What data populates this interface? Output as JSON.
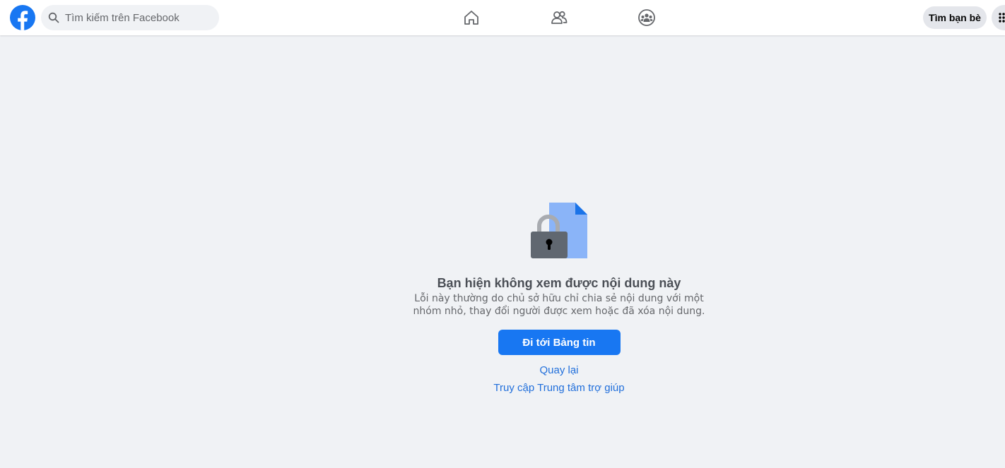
{
  "header": {
    "logo_icon": "facebook-logo-icon",
    "search": {
      "placeholder": "Tìm kiếm trên Facebook",
      "icon": "search-icon"
    },
    "nav": [
      {
        "name": "home",
        "icon": "home-icon"
      },
      {
        "name": "friends",
        "icon": "friends-icon"
      },
      {
        "name": "groups",
        "icon": "groups-icon"
      }
    ],
    "find_friends_label": "Tìm bạn bè",
    "menu_icon": "grid-menu-icon"
  },
  "main": {
    "illustration_icon": "locked-content-icon",
    "title": "Bạn hiện không xem được nội dung này",
    "description": "Lỗi này thường do chủ sở hữu chỉ chia sẻ nội dung với một nhóm nhỏ, thay đổi người được xem hoặc đã xóa nội dung.",
    "primary_button": "Đi tới Bảng tin",
    "back_link": "Quay lại",
    "help_link": "Truy cập Trung tâm trợ giúp"
  },
  "colors": {
    "brand": "#1877f2",
    "background": "#f0f2f5",
    "link": "#216fdb"
  }
}
